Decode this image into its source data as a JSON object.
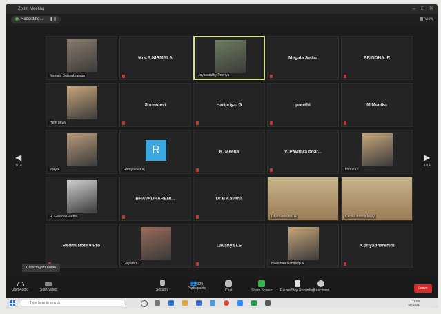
{
  "window": {
    "title": "Zoom Meeting",
    "recording": "Recording...",
    "view_label": "View",
    "controls": [
      "–",
      "□",
      "✕"
    ]
  },
  "grid": {
    "page_left": "1/14",
    "page_right": "1/14",
    "tiles": [
      {
        "kind": "video",
        "label": "Nirmala Balasubraman"
      },
      {
        "kind": "name",
        "name": "Mrs.B.NIRMALA"
      },
      {
        "kind": "video",
        "label": "Jayasarathy Peeriya",
        "highlight": true
      },
      {
        "kind": "name",
        "name": "Megala Sethu"
      },
      {
        "kind": "name",
        "name": "BRINDHA. R"
      },
      {
        "kind": "video",
        "label": "Hem priya"
      },
      {
        "kind": "name",
        "name": "Shreedevi"
      },
      {
        "kind": "name",
        "name": "Haripriya. G"
      },
      {
        "kind": "name",
        "name": "preethi"
      },
      {
        "kind": "name",
        "name": "M.Monika"
      },
      {
        "kind": "video",
        "label": "vijay k"
      },
      {
        "kind": "avatar",
        "label": "Ramya Natraj",
        "letter": "R"
      },
      {
        "kind": "name",
        "name": "K. Meena"
      },
      {
        "kind": "name",
        "name": "V. Pavithra bhar..."
      },
      {
        "kind": "video",
        "label": "komala 1"
      },
      {
        "kind": "video",
        "label": "R. Geetha Geetha"
      },
      {
        "kind": "name",
        "name": "BHAVADHARENI..."
      },
      {
        "kind": "name",
        "name": "Dr B Kavitha"
      },
      {
        "kind": "video",
        "label": "Dhanalakshmi R"
      },
      {
        "kind": "video",
        "label": "Cecilia Bosco Mary"
      },
      {
        "kind": "name",
        "name": "Redmi Note 9 Pro"
      },
      {
        "kind": "video",
        "label": "Gayathri J"
      },
      {
        "kind": "name",
        "name": "Lavanya LS"
      },
      {
        "kind": "video",
        "label": "Nivedhaa Nandeep A"
      },
      {
        "kind": "name",
        "name": "A.priyadharshini"
      }
    ]
  },
  "tooltip": "Click to join audio",
  "toolbar": {
    "join_audio": "Join Audio",
    "start_video": "Start Video",
    "security": "Security",
    "participants": "Participants",
    "participants_count": "329",
    "chat": "Chat",
    "share_screen": "Share Screen",
    "pause_recording": "Pause/Stop Recording",
    "reactions": "Reactions",
    "end": "Leave"
  },
  "taskbar": {
    "search_placeholder": "Type here to search",
    "time": "11:03",
    "date": "08-2021"
  },
  "colors": {
    "accent_highlight": "#d8dd8a",
    "share_green": "#3bb34a",
    "end_red": "#d32d2d",
    "avatar_blue": "#3aa7e0"
  }
}
